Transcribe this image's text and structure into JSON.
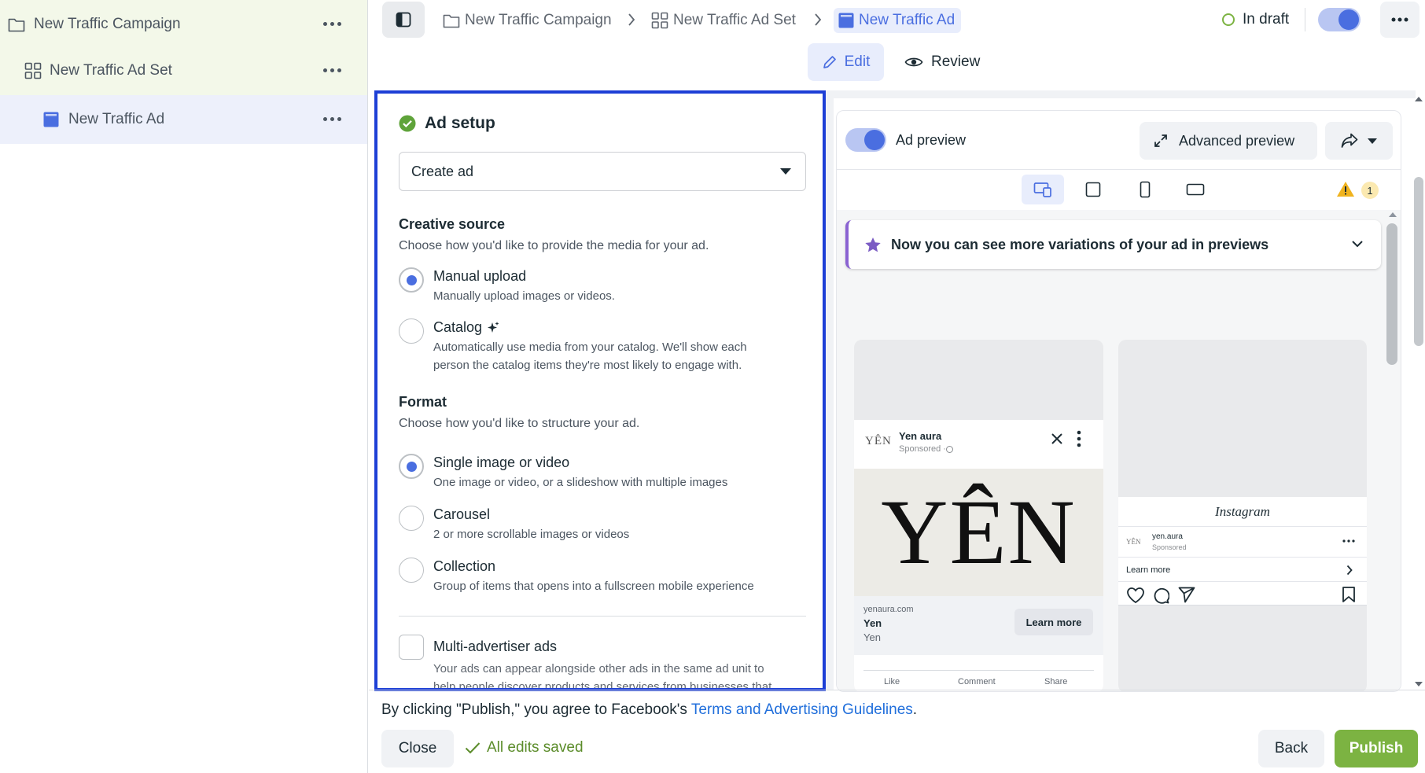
{
  "tree": {
    "items": [
      {
        "label": "New Traffic Campaign",
        "icon": "folder-icon"
      },
      {
        "label": "New Traffic Ad Set",
        "icon": "grid-icon"
      },
      {
        "label": "New Traffic Ad",
        "icon": "ad-icon"
      }
    ]
  },
  "breadcrumb": {
    "campaign": "New Traffic Campaign",
    "adset": "New Traffic Ad Set",
    "ad": "New Traffic Ad"
  },
  "status": {
    "label": "In draft"
  },
  "mode_tabs": {
    "edit": "Edit",
    "review": "Review"
  },
  "setup": {
    "title": "Ad setup",
    "dropdown_value": "Create ad",
    "creative_source": {
      "heading": "Creative source",
      "description": "Choose how you'd like to provide the media for your ad.",
      "options": [
        {
          "label": "Manual upload",
          "description": "Manually upload images or videos."
        },
        {
          "label": "Catalog",
          "description_line1": "Automatically use media from your catalog. We'll show each",
          "description_line2": "person the catalog items they're most likely to engage with."
        }
      ]
    },
    "format": {
      "heading": "Format",
      "description": "Choose how you'd like to structure your ad.",
      "options": [
        {
          "label": "Single image or video",
          "description": "One image or video, or a slideshow with multiple images"
        },
        {
          "label": "Carousel",
          "description": "2 or more scrollable images or videos"
        },
        {
          "label": "Collection",
          "description": "Group of items that opens into a fullscreen mobile experience"
        }
      ]
    },
    "multi_advertiser": {
      "label": "Multi-advertiser ads",
      "description_line1": "Your ads can appear alongside other ads in the same ad unit to",
      "description_line2": "help people discover products and services from businesses that"
    }
  },
  "preview": {
    "toggle_label": "Ad preview",
    "advanced_label": "Advanced preview",
    "warning_count": "1",
    "banner": "Now you can see more variations of your ad in previews",
    "facebook_card": {
      "brand_logo_text": "YÊN",
      "page_name": "Yen aura",
      "sponsored": "Sponsored · ",
      "hero_text": "YÊN",
      "domain": "yenaura.com",
      "headline": "Yen",
      "description": "Yen",
      "cta": "Learn more",
      "actions": [
        "Like",
        "Comment",
        "Share"
      ]
    },
    "instagram_card": {
      "app_name": "Instagram",
      "brand_logo_text": "YÊN",
      "handle": "yen.aura",
      "sponsored": "Sponsored",
      "cta": "Learn more"
    }
  },
  "footer": {
    "terms_prefix": "By clicking \"Publish,\" you agree to Facebook's ",
    "terms_link": "Terms and Advertising Guidelines",
    "terms_suffix": ".",
    "close": "Close",
    "saved": "All edits saved",
    "back": "Back",
    "publish": "Publish"
  },
  "colors": {
    "accent": "#4a6ee0",
    "link": "#216fdb",
    "publish": "#7cb342",
    "saved": "#5b8c2a",
    "highlight_border": "#1d3fd6",
    "tree_active": "#edf0fb",
    "tree_parent": "#f3f8e9"
  }
}
